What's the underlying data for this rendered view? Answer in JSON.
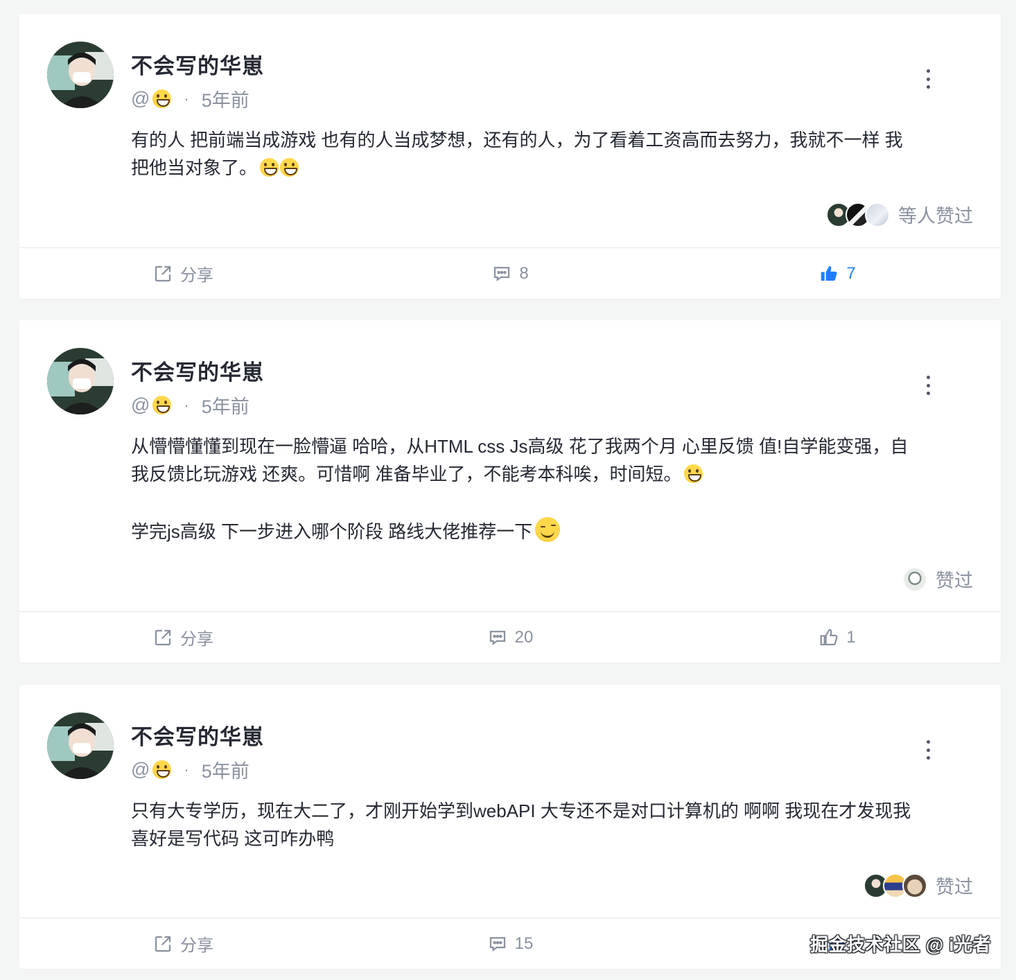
{
  "comments": [
    {
      "username": "不会写的华崽",
      "handle_prefix": "@",
      "time": "5年前",
      "separator": "·",
      "content_line1": "有的人 把前端当成游戏 也有的人当成梦想，还有的人，为了看着工资高而去努力，我就不一样 我",
      "content_line2": "把他当对象了。",
      "likers_label": "等人赞过",
      "share_label": "分享",
      "comment_count": "8",
      "like_count": "7",
      "liked": true
    },
    {
      "username": "不会写的华崽",
      "handle_prefix": "@",
      "time": "5年前",
      "separator": "·",
      "content_line1": "从懵懵懂懂到现在一脸懵逼 哈哈，从HTML css Js高级 花了我两个月 心里反馈 值!自学能变强，自",
      "content_line2": "我反馈比玩游戏 还爽。可惜啊 准备毕业了，不能考本科唉，时间短。",
      "content_line3": "学完js高级 下一步进入哪个阶段 路线大佬推荐一下",
      "likers_label": "赞过",
      "share_label": "分享",
      "comment_count": "20",
      "like_count": "1",
      "liked": false
    },
    {
      "username": "不会写的华崽",
      "handle_prefix": "@",
      "time": "5年前",
      "separator": "·",
      "content_line1": "只有大专学历，现在大二了，才刚开始学到webAPI 大专还不是对口计算机的 啊啊 我现在才发现我",
      "content_line2": "喜好是写代码 这可咋办鸭",
      "likers_label": "赞过",
      "share_label": "分享",
      "comment_count": "15"
    }
  ],
  "watermark": "掘金技术社区 @ i光者",
  "colors": {
    "accent": "#1e80ff",
    "muted": "#8a919f",
    "text": "#252933",
    "background": "#f4f5f5"
  }
}
